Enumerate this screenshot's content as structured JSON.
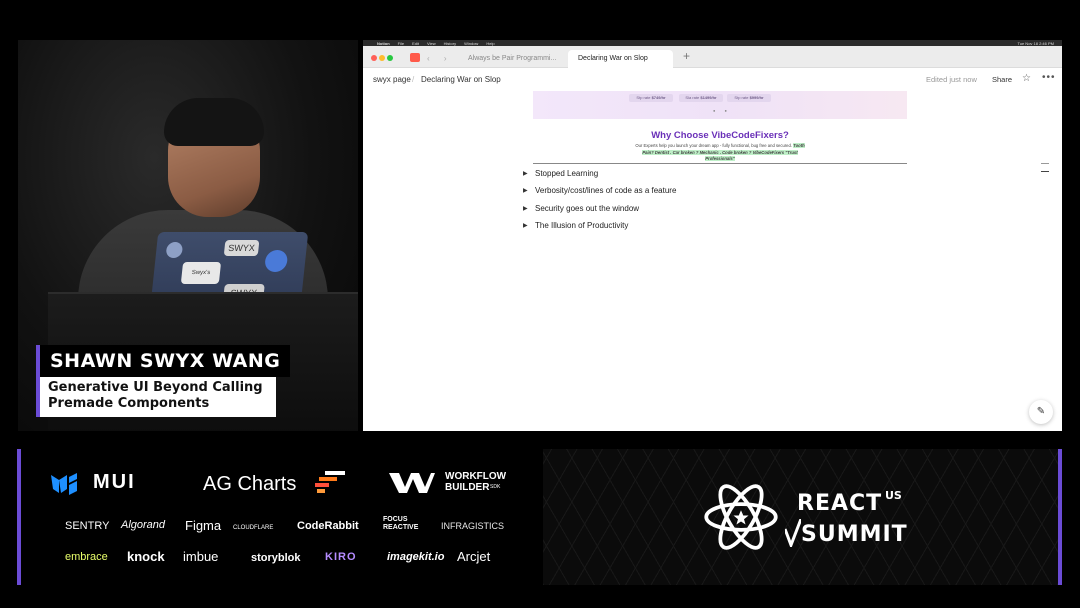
{
  "speaker": {
    "name": "SHAWN SWYX WANG",
    "talk_title_line1": "Generative UI Beyond Calling",
    "talk_title_line2": "Premade Components",
    "laptop_stickers": [
      "SWYX",
      "Swyx's",
      "SWYX"
    ]
  },
  "browser": {
    "menubar": [
      "Notion",
      "File",
      "Edit",
      "View",
      "History",
      "Window",
      "Help"
    ],
    "clock": "Tue Nov 18 2:46 PM",
    "tabs": [
      {
        "label": "Always be Pair Programmi...",
        "active": false
      },
      {
        "label": "Declaring War on Slop",
        "active": true
      }
    ],
    "new_tab_label": "+",
    "nav_arrows": "‹ ›"
  },
  "notion": {
    "breadcrumb": [
      "swyx page",
      "Declaring War on Slop"
    ],
    "breadcrumb_sep": "/",
    "edited": "Edited just now",
    "share_label": "Share",
    "hero": {
      "prices": [
        "$749/hr",
        "$1499/hr",
        "$999/hr"
      ],
      "price_labels": [
        "Stp rate",
        "Sla rate",
        "Stp rate"
      ],
      "why_title": "Why Choose VibeCodeFixers?",
      "why_body": "Our Experts help you launch your dream app - fully functional, bug free and secured.",
      "why_highlight": "Tooth Pain? Dentist . Car broken ? Mechanic . Code broken ? VibeCodeFixers \"Trust Professionals\""
    },
    "toggles": [
      "Stopped Learning",
      "Verbosity/cost/lines of code as a feature",
      "Security goes out the window",
      "The Illusion of Productivity"
    ]
  },
  "sponsors": {
    "row1": [
      "MUI",
      "AG Charts",
      "WORKFLOW",
      "BUILDER"
    ],
    "row2": [
      "SENTRY",
      "Algorand",
      "Figma",
      "CLOUDFLARE",
      "CodeRabbit",
      "FOCUS REACTIVE",
      "INFRAGISTICS"
    ],
    "row3": [
      "embrace",
      "knock",
      "imbue",
      "storyblok",
      "KIRO",
      "imagekit.io",
      "Arcjet"
    ],
    "builder_sub": "SDK"
  },
  "event": {
    "word1": "REACT",
    "superscript": "US",
    "word2": "SUMMIT"
  },
  "colors": {
    "accent": "#6b4cd6",
    "notion_title": "#6a30b8",
    "highlight": "#bff0c8"
  }
}
